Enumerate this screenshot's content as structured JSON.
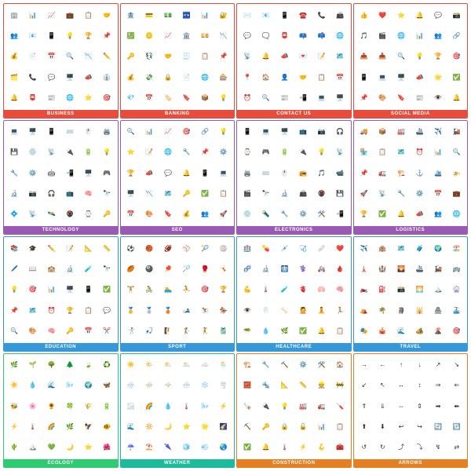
{
  "categories": [
    {
      "id": "business",
      "label": "Business",
      "theme": "card-business",
      "icons": [
        "🏢",
        "📊",
        "📈",
        "💼",
        "📋",
        "🤝",
        "👥",
        "📧",
        "📱",
        "💡",
        "🏆",
        "📌",
        "💰",
        "📄",
        "📅",
        "🔍",
        "📉",
        "✏️",
        "🗂️",
        "📞",
        "💬",
        "🖥️",
        "📣",
        "👔",
        "🔔",
        "📮",
        "📰",
        "🌐",
        "⭐",
        "🎯"
      ]
    },
    {
      "id": "banking",
      "label": "Banking",
      "theme": "card-banking",
      "icons": [
        "🏦",
        "💳",
        "💵",
        "🏧",
        "📊",
        "🔐",
        "💹",
        "🪙",
        "📈",
        "🏛️",
        "💴",
        "📉",
        "🔑",
        "💱",
        "🤝",
        "🧾",
        "📋",
        "📌",
        "💰",
        "💸",
        "🔒",
        "📄",
        "🌐",
        "🎰",
        "💎",
        "📅",
        "🏷️",
        "🔖",
        "📦",
        "💡"
      ]
    },
    {
      "id": "contact",
      "label": "Contact Us",
      "theme": "card-contact",
      "icons": [
        "✉️",
        "📧",
        "📱",
        "☎️",
        "📞",
        "📠",
        "💬",
        "🗨️",
        "📮",
        "📪",
        "📫",
        "🌐",
        "📡",
        "🔔",
        "📣",
        "💌",
        "📝",
        "🗺️",
        "📍",
        "🏠",
        "👤",
        "🤝",
        "📋",
        "📅",
        "⏰",
        "🔍",
        "📰",
        "📲",
        "💻",
        "🖥️"
      ]
    },
    {
      "id": "social",
      "label": "Social Media",
      "theme": "card-social",
      "icons": [
        "👍",
        "❤️",
        "⭐",
        "🔔",
        "💬",
        "📸",
        "🎵",
        "🎬",
        "🌐",
        "📊",
        "👥",
        "🔗",
        "📤",
        "📥",
        "🔍",
        "💡",
        "🏆",
        "🎯",
        "📱",
        "💻",
        "🖥️",
        "📣",
        "🌟",
        "✅",
        "📌",
        "🎨",
        "🔖",
        "📰",
        "👁️",
        "🔔"
      ]
    },
    {
      "id": "technology",
      "label": "Technology",
      "theme": "card-technology",
      "icons": [
        "💻",
        "🖥️",
        "📱",
        "⌨️",
        "🖱️",
        "🖨️",
        "💾",
        "💿",
        "📡",
        "🔌",
        "🔋",
        "💡",
        "🔧",
        "⚙️",
        "🤖",
        "📲",
        "🖥️",
        "🎮",
        "🔬",
        "📷",
        "🎧",
        "📺",
        "🧠",
        "🔭",
        "💠",
        "📡",
        "🛰️",
        "🖲️",
        "⌚",
        "🔑"
      ]
    },
    {
      "id": "seo",
      "label": "SEO",
      "theme": "card-seo",
      "icons": [
        "🔍",
        "📊",
        "📈",
        "🎯",
        "🔗",
        "💡",
        "⭐",
        "📝",
        "🌐",
        "🔧",
        "📌",
        "⚙️",
        "🏆",
        "📣",
        "💬",
        "🔔",
        "📱",
        "💻",
        "🖥️",
        "📉",
        "🗺️",
        "🔑",
        "✅",
        "📋",
        "📅",
        "🎨",
        "🔖",
        "💰",
        "👥",
        "🚀"
      ]
    },
    {
      "id": "electronics",
      "label": "Electronics",
      "theme": "card-electronics",
      "icons": [
        "📱",
        "💻",
        "🖥️",
        "📺",
        "📷",
        "🎧",
        "⌚",
        "🎮",
        "🔋",
        "🔌",
        "💡",
        "📡",
        "🖨️",
        "⌨️",
        "🖱️",
        "📻",
        "🎵",
        "📹",
        "🎬",
        "🔭",
        "🔬",
        "📠",
        "🖲️",
        "💾",
        "💿",
        "🔦",
        "🔧",
        "⚙️",
        "🛠️",
        "📲"
      ]
    },
    {
      "id": "logistics",
      "label": "Logistics",
      "theme": "card-logistics",
      "icons": [
        "🚚",
        "📦",
        "🏭",
        "🚢",
        "✈️",
        "🚂",
        "🏪",
        "📋",
        "🗺️",
        "⏰",
        "📊",
        "🔍",
        "📌",
        "🚛",
        "🏗️",
        "⚓",
        "🛳️",
        "🚁",
        "🚀",
        "📡",
        "🔧",
        "⚙️",
        "📅",
        "💼",
        "🏆",
        "✅",
        "🔔",
        "📣",
        "👥",
        "🌐"
      ]
    },
    {
      "id": "education",
      "label": "Education",
      "theme": "card-education",
      "icons": [
        "📚",
        "🎓",
        "✏️",
        "📝",
        "📐",
        "📏",
        "🖊️",
        "📖",
        "🏫",
        "🔬",
        "🧪",
        "🔭",
        "💡",
        "🎯",
        "📊",
        "🖥️",
        "📱",
        "✅",
        "📌",
        "🗺️",
        "⏰",
        "🏆",
        "📋",
        "💬",
        "🔍",
        "🎨",
        "🧠",
        "🔑",
        "📅",
        "✂️"
      ]
    },
    {
      "id": "sport",
      "label": "Sport",
      "theme": "card-sport",
      "icons": [
        "⚽",
        "🏀",
        "🏈",
        "⚾",
        "🎾",
        "🏐",
        "🏉",
        "🎱",
        "🏓",
        "🏸",
        "🥊",
        "🤸",
        "🏋️",
        "🚴",
        "🏊",
        "⛹️",
        "🎯",
        "🏆",
        "🥇",
        "🥈",
        "🥉",
        "🎿",
        "⛷️",
        "🏇",
        "🤺",
        "🎣",
        "🧗",
        "🏌️",
        "🤾",
        "🎽"
      ]
    },
    {
      "id": "healthcare",
      "label": "Healthcare",
      "theme": "card-healthcare",
      "icons": [
        "🏥",
        "💊",
        "💉",
        "🩺",
        "🩹",
        "❤️",
        "🧬",
        "🔬",
        "🩻",
        "⚕️",
        "🚑",
        "🩸",
        "💪",
        "🌡️",
        "🧪",
        "🫀",
        "🫁",
        "🧠",
        "👁️",
        "🦷",
        "🦴",
        "💆",
        "🧘",
        "🏃",
        "🥗",
        "💧",
        "🌿",
        "✅",
        "🔔",
        "📋"
      ]
    },
    {
      "id": "travel",
      "label": "Travel",
      "theme": "card-travel",
      "icons": [
        "✈️",
        "🏨",
        "🗺️",
        "🧳",
        "🌍",
        "🏖️",
        "🗼",
        "🏰",
        "🌄",
        "🚢",
        "🚂",
        "🚌",
        "🏍️",
        "⛽",
        "📸",
        "🌅",
        "🏔️",
        "🎡",
        "⛺",
        "🌴",
        "🗿",
        "🕌",
        "🏯",
        "🚠",
        "🎭",
        "🎪",
        "🌊",
        "🏕️",
        "🌋",
        "🎯"
      ]
    },
    {
      "id": "ecology",
      "label": "Ecology",
      "theme": "card-ecology",
      "icons": [
        "🌿",
        "🌱",
        "🌳",
        "🌲",
        "🍃",
        "♻️",
        "☀️",
        "💧",
        "🌊",
        "🌬️",
        "🌍",
        "🦋",
        "🐝",
        "🌸",
        "🌻",
        "🍀",
        "🌾",
        "🔋",
        "⚡",
        "🌡️",
        "🌈",
        "🌿",
        "🦅",
        "🐠",
        "🌵",
        "🏔️",
        "💚",
        "🌙",
        "⭐",
        "🌺"
      ]
    },
    {
      "id": "weather",
      "label": "Weather",
      "theme": "card-weather",
      "icons": [
        "☀️",
        "🌤️",
        "⛅",
        "🌥️",
        "☁️",
        "🌦️",
        "🌧️",
        "⛈️",
        "🌩️",
        "🌨️",
        "❄️",
        "🌪️",
        "🌫️",
        "🌈",
        "💧",
        "🌡️",
        "🌬️",
        "⚡",
        "🌊",
        "🔆",
        "🌙",
        "⭐",
        "🌟",
        "🌠",
        "☔",
        "⛱️",
        "🌂",
        "🧊",
        "💨",
        "🌏"
      ]
    },
    {
      "id": "construction",
      "label": "Construction",
      "theme": "card-construction",
      "icons": [
        "🏗️",
        "🔧",
        "🔨",
        "⚙️",
        "🛠️",
        "🏠",
        "🧱",
        "🔩",
        "📐",
        "📏",
        "👷",
        "🚧",
        "🪚",
        "🔌",
        "💡",
        "🏭",
        "🚛",
        "🪛",
        "⛏️",
        "🔑",
        "🔒",
        "🔓",
        "📊",
        "📋",
        "✅",
        "🔔",
        "🌡️",
        "⚡",
        "🪝",
        "🧰"
      ]
    },
    {
      "id": "arrows",
      "label": "Arrows",
      "theme": "card-arrows",
      "icons": [
        "→",
        "←",
        "↑",
        "↓",
        "↗",
        "↘",
        "↙",
        "↖",
        "↔",
        "↕",
        "⇒",
        "⇐",
        "⇑",
        "⇓",
        "⇔",
        "⇕",
        "➡",
        "⬅",
        "⬆",
        "⬇",
        "↩",
        "↪",
        "🔄",
        "🔃",
        "↺",
        "↻",
        "⤴",
        "⤵",
        "↯",
        "⇄"
      ]
    }
  ]
}
